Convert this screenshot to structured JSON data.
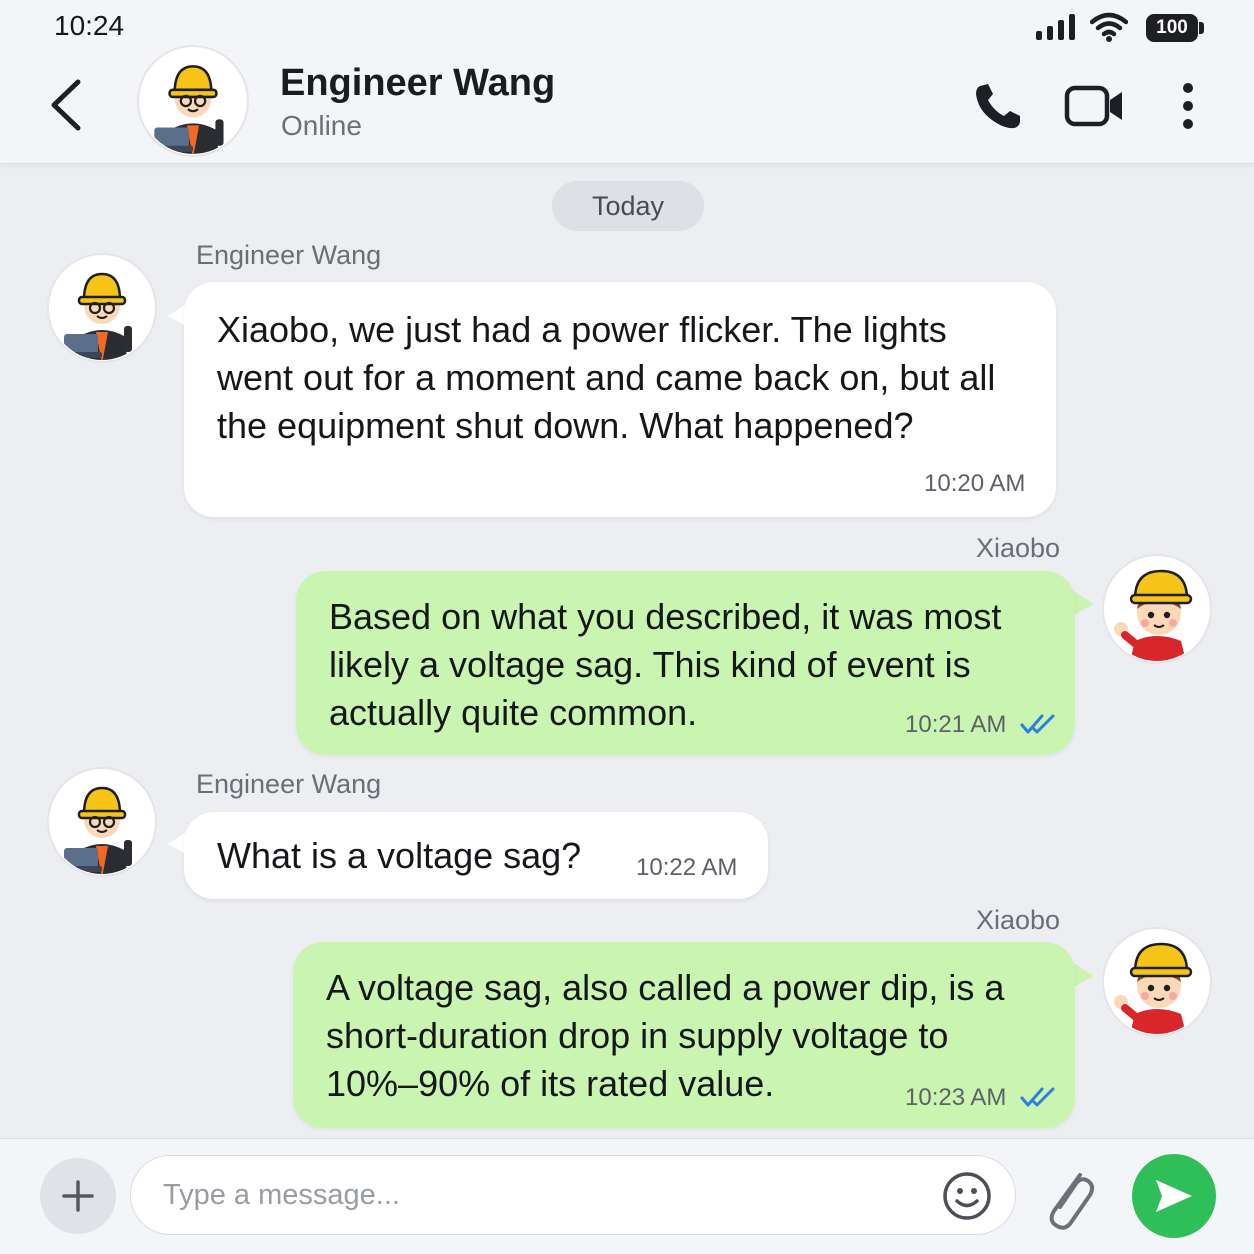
{
  "status_bar": {
    "time": "10:24",
    "battery": "100"
  },
  "header": {
    "contact_name": "Engineer Wang",
    "contact_status": "Online"
  },
  "date_divider": "Today",
  "messages": [
    {
      "sender": "Engineer Wang",
      "direction": "incoming",
      "text": "Xiaobo,  we just had a power flicker. The lights went out for a moment and came back on, but all the equipment shut down. What happened?",
      "time": "10:20 AM"
    },
    {
      "sender": "Xiaobo",
      "direction": "outgoing",
      "text": "Based on what you described, it was most likely a voltage sag. This kind of event is actually quite common.",
      "time": "10:21 AM",
      "read": true
    },
    {
      "sender": "Engineer Wang",
      "direction": "incoming",
      "text": "What is a voltage sag?",
      "time": "10:22 AM"
    },
    {
      "sender": "Xiaobo",
      "direction": "outgoing",
      "text": "A voltage sag, also called a power dip, is a short-duration drop in supply voltage to 10%–90% of its rated value.",
      "time": "10:23 AM",
      "read": true
    }
  ],
  "composer": {
    "placeholder": "Type a message..."
  },
  "icons": {
    "back": "chevron-left-icon",
    "call": "phone-icon",
    "video": "video-camera-icon",
    "more": "more-vertical-icon",
    "add": "plus-icon",
    "emoji": "smiley-icon",
    "attach": "paperclip-icon",
    "send": "send-icon",
    "read_receipt": "double-check-icon"
  },
  "colors": {
    "incoming_bubble": "#ffffff",
    "outgoing_bubble": "#c9f5b0",
    "send_button": "#2fbf58",
    "read_check": "#2a7fe0",
    "background": "#eceef1"
  }
}
